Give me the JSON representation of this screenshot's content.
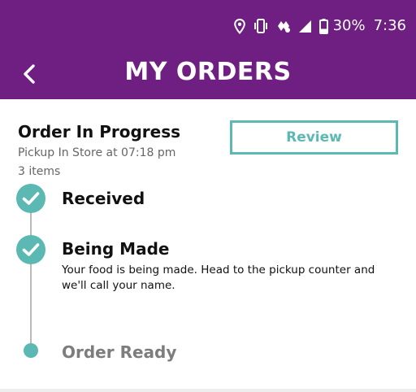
{
  "status_bar": {
    "battery": "30%",
    "time": "7:36",
    "icons": [
      "location-icon",
      "vibrate-icon",
      "data-saver-icon",
      "signal-icon",
      "battery-icon"
    ]
  },
  "app_bar": {
    "title": "MY ORDERS",
    "back_icon": "chevron-left-icon",
    "background": "#6f1f82"
  },
  "order": {
    "status_title": "Order In Progress",
    "pickup_text": "Pickup In Store at 07:18 pm",
    "items_count": "3 items",
    "review_label": "Review"
  },
  "timeline": {
    "steps": [
      {
        "label": "Received",
        "state": "complete"
      },
      {
        "label": "Being Made",
        "state": "complete",
        "description": "Your food is being made. Head to the pickup counter and we'll call your name."
      },
      {
        "label": "Order Ready",
        "state": "pending"
      }
    ]
  },
  "colors": {
    "brand_purple": "#6f1f82",
    "accent_teal": "#5cb8b2",
    "muted_gray": "#7d7d7d"
  }
}
